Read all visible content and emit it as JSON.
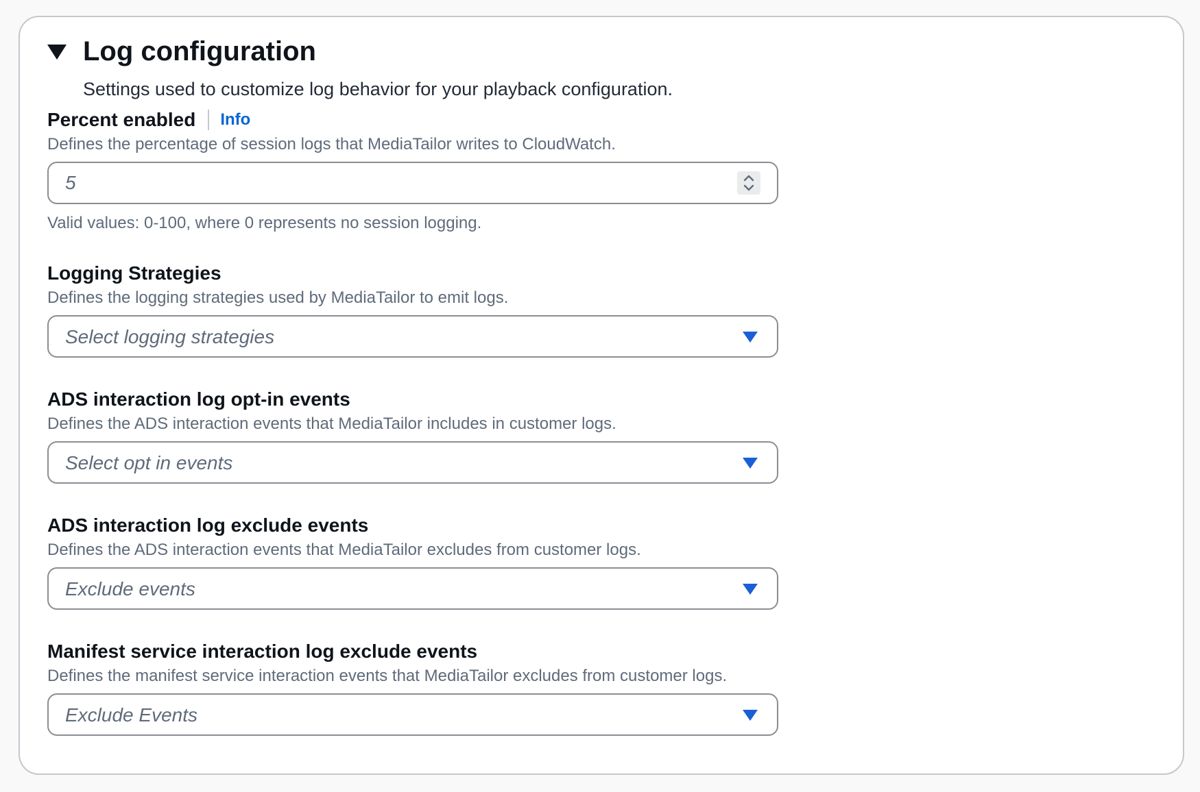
{
  "section": {
    "title": "Log configuration",
    "subtitle": "Settings used to customize log behavior for your playback configuration."
  },
  "percent_enabled": {
    "label": "Percent enabled",
    "info_link": "Info",
    "description": "Defines the percentage of session logs that MediaTailor writes to CloudWatch.",
    "value": "5",
    "hint": "Valid values: 0-100, where 0 represents no session logging."
  },
  "logging_strategies": {
    "label": "Logging Strategies",
    "description": "Defines the logging strategies used by MediaTailor to emit logs.",
    "placeholder": "Select logging strategies"
  },
  "ads_opt_in": {
    "label": "ADS interaction log opt-in events",
    "description": "Defines the ADS interaction events that MediaTailor includes in customer logs.",
    "placeholder": "Select opt in events"
  },
  "ads_exclude": {
    "label": "ADS interaction log exclude events",
    "description": "Defines the ADS interaction events that MediaTailor excludes from customer logs.",
    "placeholder": "Exclude events"
  },
  "manifest_exclude": {
    "label": "Manifest service interaction log exclude events",
    "description": "Defines the manifest service interaction events that MediaTailor excludes from customer logs.",
    "placeholder": "Exclude Events"
  },
  "colors": {
    "link": "#0665d6",
    "dropdown_arrow": "#1a5fd6",
    "border": "#8c8c94"
  }
}
